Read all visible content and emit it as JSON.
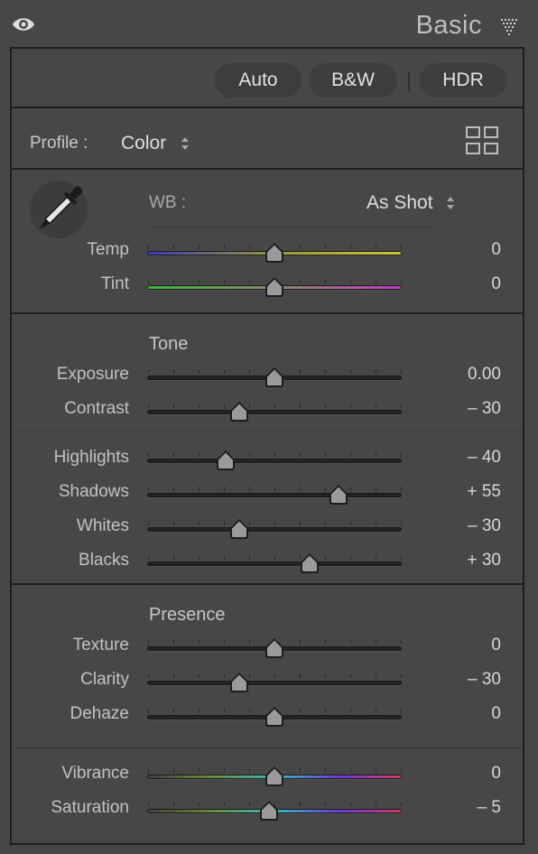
{
  "header": {
    "title": "Basic"
  },
  "top_buttons": {
    "auto": "Auto",
    "bw": "B&W",
    "hdr": "HDR"
  },
  "profile": {
    "label": "Profile :",
    "value": "Color"
  },
  "wb": {
    "label": "WB :",
    "value": "As Shot"
  },
  "sliders": {
    "temp": {
      "label": "Temp",
      "value": "0",
      "level": 0.5
    },
    "tint": {
      "label": "Tint",
      "value": "0",
      "level": 0.5
    },
    "exposure": {
      "label": "Exposure",
      "value": "0.00",
      "level": 0.5
    },
    "contrast": {
      "label": "Contrast",
      "value": "– 30",
      "level": 0.36
    },
    "highlights": {
      "label": "Highlights",
      "value": "– 40",
      "level": 0.31
    },
    "shadows": {
      "label": "Shadows",
      "value": "+ 55",
      "level": 0.75
    },
    "whites": {
      "label": "Whites",
      "value": "– 30",
      "level": 0.36
    },
    "blacks": {
      "label": "Blacks",
      "value": "+ 30",
      "level": 0.64
    },
    "texture": {
      "label": "Texture",
      "value": "0",
      "level": 0.5
    },
    "clarity": {
      "label": "Clarity",
      "value": "– 30",
      "level": 0.36
    },
    "dehaze": {
      "label": "Dehaze",
      "value": "0",
      "level": 0.5
    },
    "vibrance": {
      "label": "Vibrance",
      "value": "0",
      "level": 0.5
    },
    "saturation": {
      "label": "Saturation",
      "value": "– 5",
      "level": 0.48
    }
  },
  "sections": {
    "tone": "Tone",
    "presence": "Presence"
  },
  "colors": {
    "temp": [
      "#3a3ab8",
      "#9a9a3a",
      "#d0c63a"
    ],
    "tint": [
      "#3ab83a",
      "#8a8a6a",
      "#c43ac4"
    ],
    "vibrance": [
      "#404040",
      "#6a8a3a",
      "#3ab8b8",
      "#6a3ad0",
      "#d03a6a"
    ],
    "saturation": [
      "#404040",
      "#6a8a3a",
      "#3ab8b8",
      "#6a3ad0",
      "#d03a6a"
    ]
  }
}
